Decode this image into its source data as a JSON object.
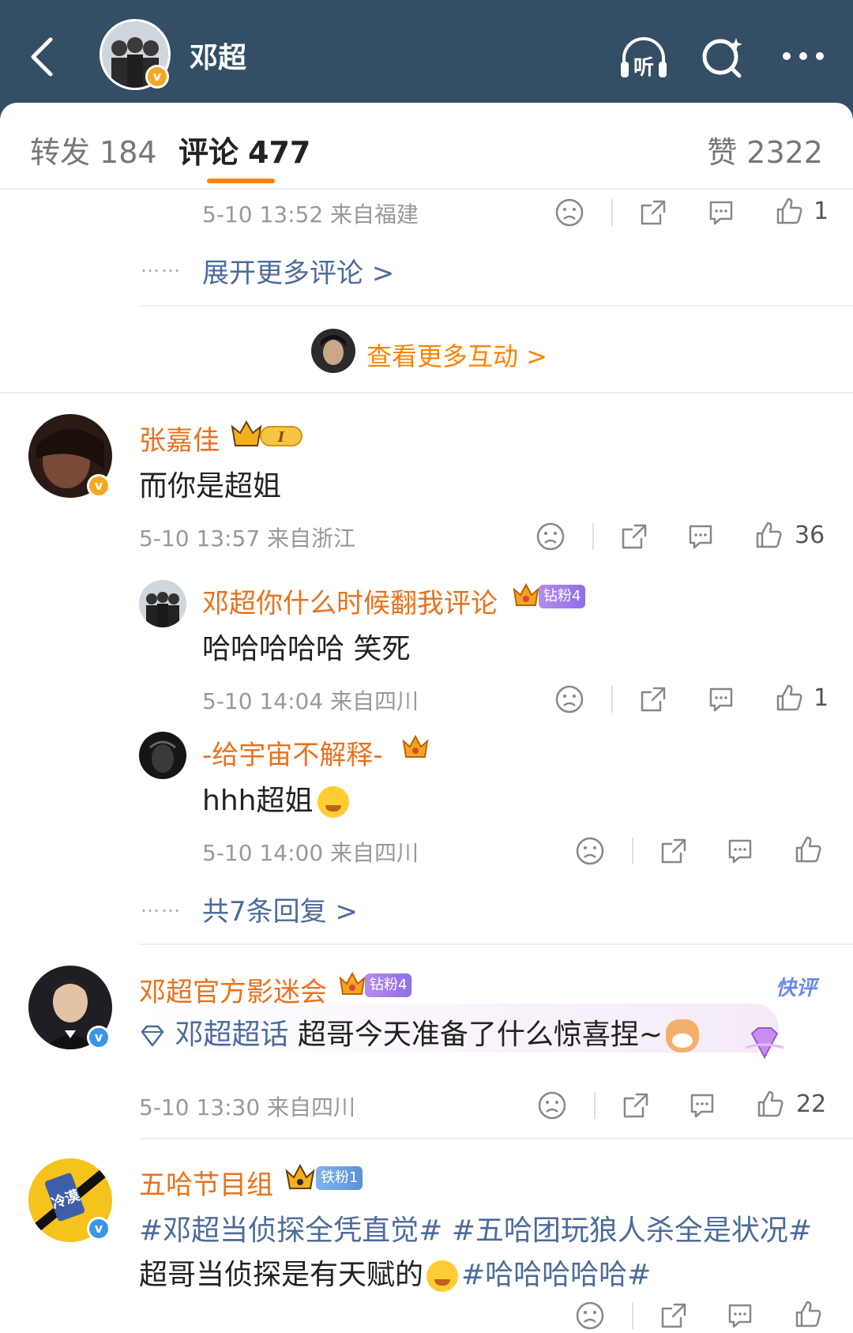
{
  "header": {
    "title": "邓超",
    "listen_icon_label": "听",
    "icons": [
      "back-arrow-icon",
      "headphones-icon",
      "search-icon",
      "more-icon"
    ]
  },
  "tabs": {
    "repost_label": "转发",
    "repost_count": "184",
    "comment_label": "评论",
    "comment_count": "477",
    "like_label": "赞",
    "like_count": "2322"
  },
  "accent": "#ff8200",
  "top_reply": {
    "meta": "5-10 13:52 来自福建",
    "likes": "1"
  },
  "expand_more": {
    "dots": "……",
    "label": "展开更多评论 >"
  },
  "more_interactions": {
    "label": "查看更多互动 >"
  },
  "comments": [
    {
      "user": "张嘉佳",
      "text": "而你是超姐",
      "meta": "5-10 13:57 来自浙江",
      "likes": "36",
      "replies": [
        {
          "user": "邓超你什么时候翻我评论",
          "badge": "钻粉4",
          "text": "哈哈哈哈哈 笑死",
          "meta": "5-10 14:04 来自四川",
          "likes": "1"
        },
        {
          "user": "-给宇宙不解释-",
          "text": "hhh超姐",
          "meta": "5-10 14:00 来自四川",
          "likes": ""
        }
      ],
      "reply_summary": {
        "dots": "……",
        "label": "共7条回复 >"
      }
    },
    {
      "user": "邓超官方影迷会",
      "badge": "钻粉4",
      "tag": "快评",
      "supertopic": "邓超超话",
      "text": "超哥今天准备了什么惊喜捏~",
      "meta": "5-10 13:30 来自四川",
      "likes": "22"
    },
    {
      "user": "五哈节目组",
      "badge": "铁粉1",
      "avatar_text": "冷漠",
      "line1": "#邓超当侦探全凭直觉# #五哈团玩狼人杀全是状况#",
      "line2_a": "超哥当侦探是有天赋的",
      "line2_b": "#哈哈哈哈哈#"
    }
  ]
}
